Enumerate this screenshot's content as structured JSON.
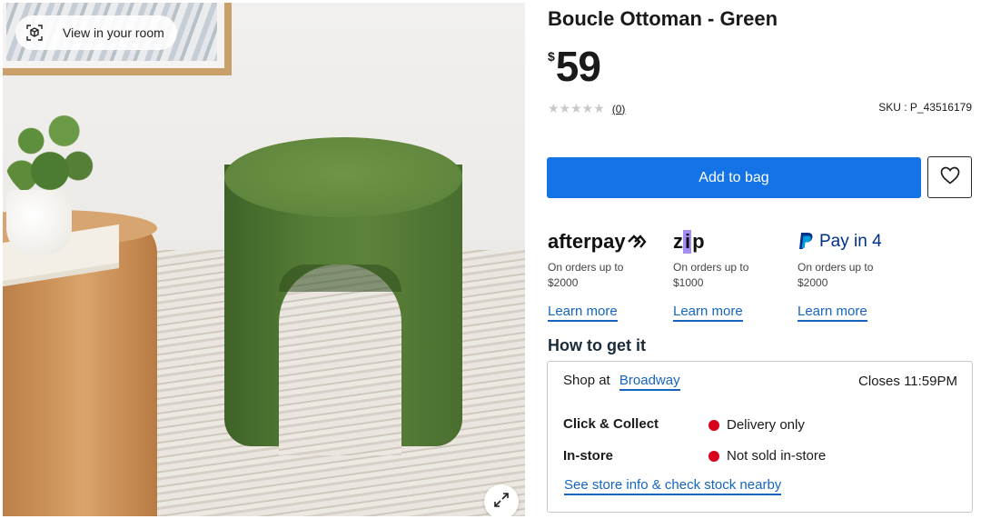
{
  "gallery": {
    "view_in_room_label": "View in your room",
    "view_in_room_icon": "ar-cube-icon",
    "expand_icon": "expand-arrows-icon"
  },
  "product": {
    "title": "Boucle Ottoman - Green",
    "currency": "$",
    "price": "59",
    "stars": "★★★★★",
    "rating_value": 0,
    "review_count": "(0)",
    "sku": "SKU : P_43516179"
  },
  "actions": {
    "add_to_bag": "Add to bag",
    "wishlist_icon": "heart-outline-icon"
  },
  "payment_options": [
    {
      "provider": "afterpay",
      "logo_text": "afterpay",
      "note": "On orders up to $2000",
      "link": "Learn more"
    },
    {
      "provider": "zip",
      "logo_text": "zip",
      "note": "On orders up to $1000",
      "link": "Learn more"
    },
    {
      "provider": "paypal",
      "logo_text": "Pay in 4",
      "note": "On orders up to $2000",
      "link": "Learn more"
    }
  ],
  "fulfilment": {
    "heading": "How to get it",
    "shop_at_label": "Shop at",
    "store_name": "Broadway",
    "closes": "Closes 11:59PM",
    "rows": [
      {
        "label": "Click & Collect",
        "status": "Delivery only"
      },
      {
        "label": "In-store",
        "status": "Not sold in-store"
      }
    ],
    "stock_link": "See store info & check stock nearby"
  },
  "colors": {
    "primary_blue": "#1473e6",
    "link_blue": "#1565c0",
    "status_red": "#d9001b",
    "zip_purple": "#a68df5",
    "paypal_navy": "#003087"
  }
}
